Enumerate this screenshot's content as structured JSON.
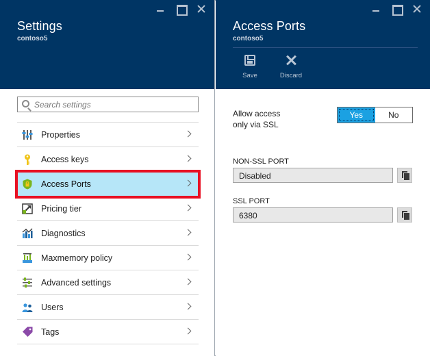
{
  "left_blade": {
    "title": "Settings",
    "subtitle": "contoso5",
    "search": {
      "placeholder": "Search settings",
      "value": ""
    },
    "menu": [
      {
        "label": "Properties",
        "icon": "properties-icon"
      },
      {
        "label": "Access keys",
        "icon": "key-icon"
      },
      {
        "label": "Access Ports",
        "icon": "shield-lock-icon",
        "selected": true
      },
      {
        "label": "Pricing tier",
        "icon": "pricing-tier-icon"
      },
      {
        "label": "Diagnostics",
        "icon": "diagnostics-chart-icon"
      },
      {
        "label": "Maxmemory policy",
        "icon": "memory-policy-icon"
      },
      {
        "label": "Advanced settings",
        "icon": "sliders-icon"
      },
      {
        "label": "Users",
        "icon": "users-icon"
      },
      {
        "label": "Tags",
        "icon": "tag-icon"
      }
    ]
  },
  "right_blade": {
    "title": "Access Ports",
    "subtitle": "contoso5",
    "commands": {
      "save": "Save",
      "discard": "Discard"
    },
    "ssl_only": {
      "label_line1": "Allow access",
      "label_line2": "only via SSL",
      "yes": "Yes",
      "no": "No",
      "selected": "Yes"
    },
    "non_ssl_port": {
      "label": "NON-SSL PORT",
      "value": "Disabled"
    },
    "ssl_port": {
      "label": "SSL PORT",
      "value": "6380"
    }
  },
  "colors": {
    "header_bg": "#003564",
    "selected_row_bg": "#b6e6f8",
    "selected_row_border": "#e81123",
    "toggle_active": "#1ba1e2"
  }
}
